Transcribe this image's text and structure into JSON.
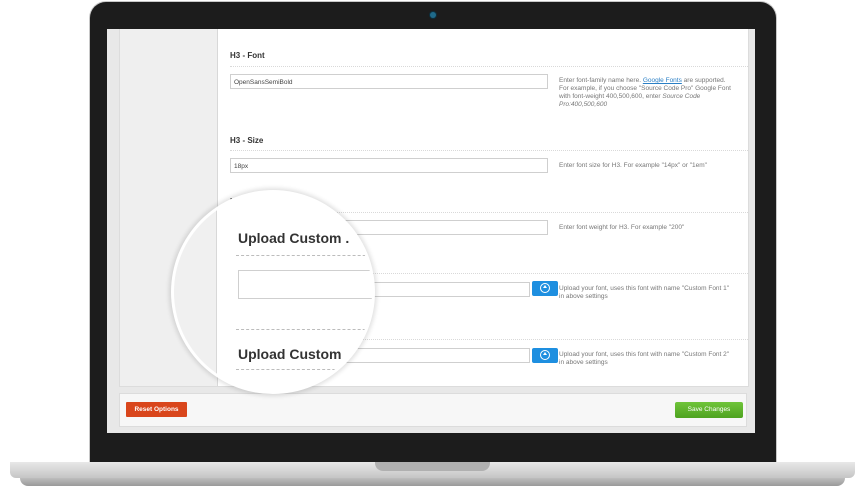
{
  "settings": {
    "h3_font": {
      "label": "H3 - Font",
      "value": "OpenSansSemiBold",
      "desc_before_link": "Enter font-family name here. ",
      "desc_link": "Google Fonts",
      "desc_after_link": " are supported. For example, if you choose \"Source Code Pro\" Google Font with font-weight 400,500,600, enter ",
      "desc_example": "Source Code Pro:400,500,600"
    },
    "h3_size": {
      "label": "H3 - Size",
      "value": "18px",
      "desc": "Enter font size for H3. For example \"14px\" or \"1em\""
    },
    "h3_weight": {
      "label_partial": "H3",
      "desc": "Enter font weight for H3. For example \"200\""
    },
    "custom_font_1": {
      "desc": "Upload your font, uses this font with name \"Custom Font 1\" in above settings",
      "upload_icon": "upload-icon"
    },
    "custom_font_2": {
      "desc": "Upload your font, uses this font with name \"Custom Font 2\" in above settings",
      "upload_icon": "upload-icon"
    }
  },
  "footer": {
    "reset_label": "Reset Options",
    "save_label": "Save Changes"
  },
  "magnifier": {
    "title_1": "Upload Custom .",
    "title_2": "Upload Custom"
  },
  "colors": {
    "reset": "#d9461c",
    "save": "#5cb82c",
    "upload": "#1e8fe0",
    "link": "#2a7fc5"
  }
}
